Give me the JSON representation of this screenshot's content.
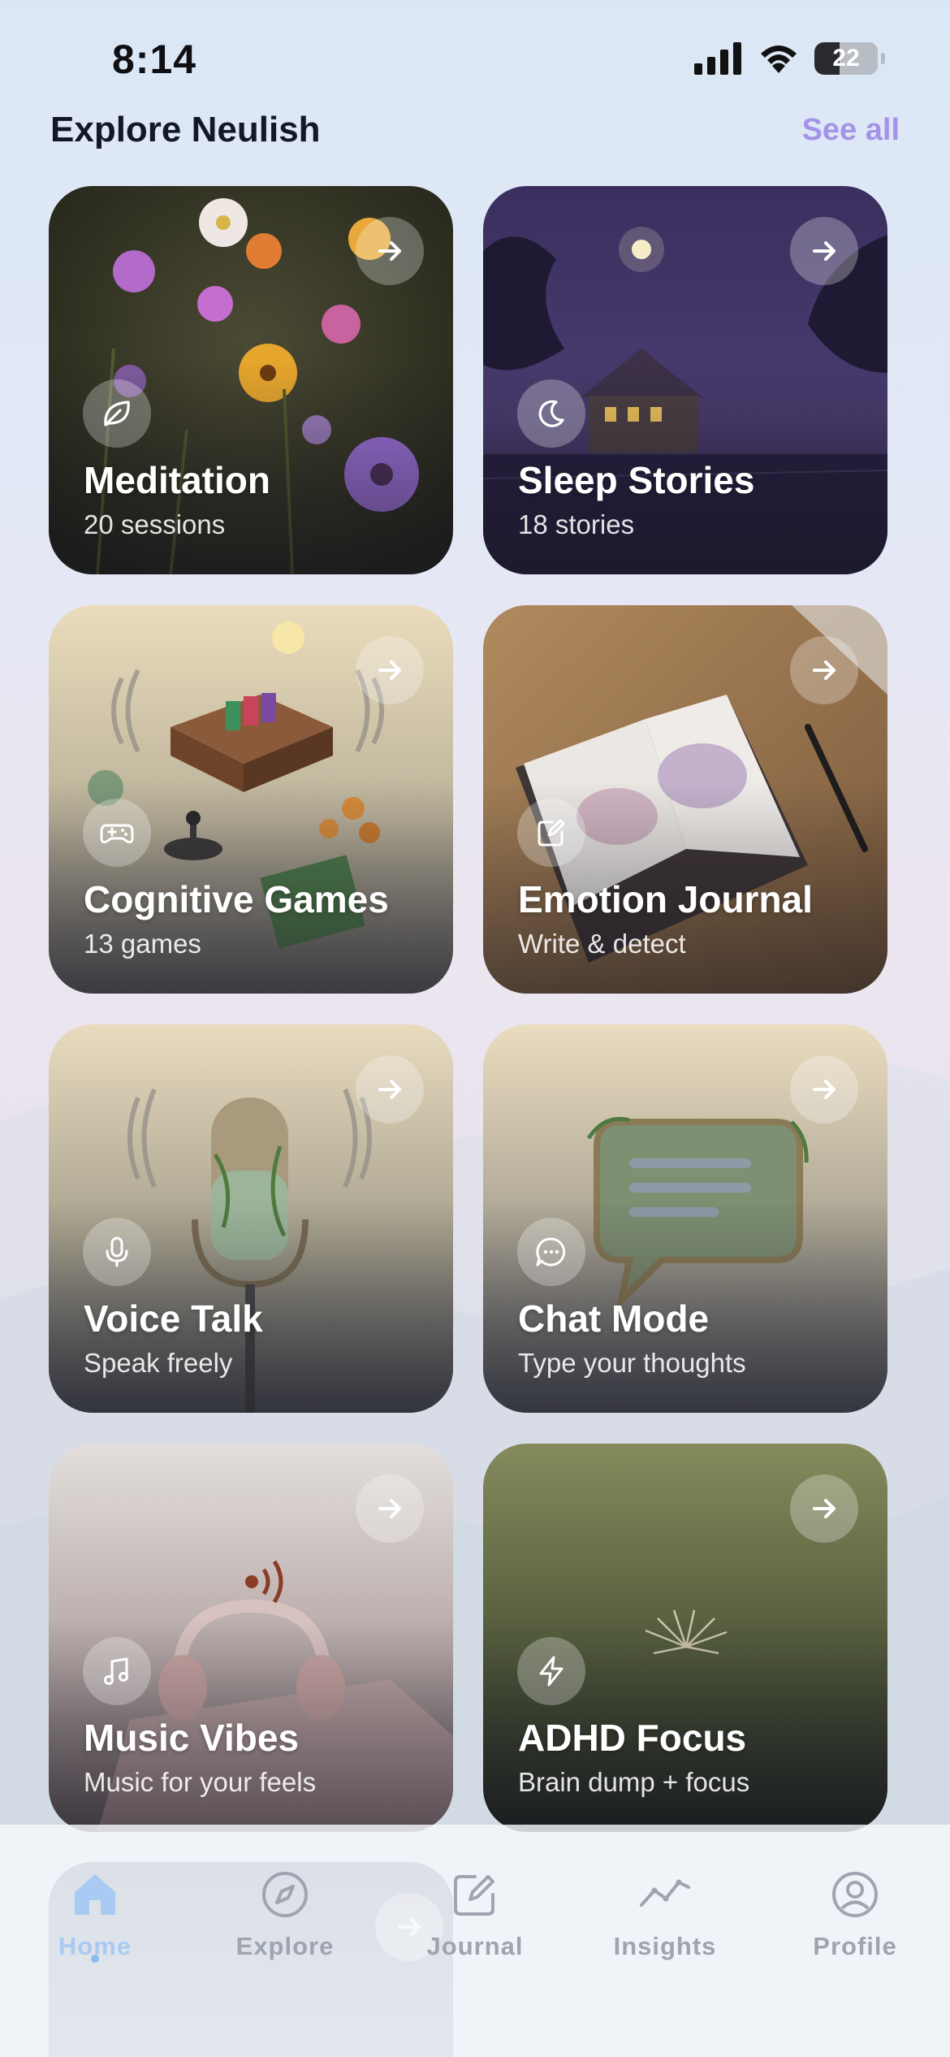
{
  "status_bar": {
    "time": "8:14",
    "battery": "22"
  },
  "header": {
    "title": "Explore Neulish",
    "see_all": "See all"
  },
  "cards": [
    {
      "title": "Meditation",
      "subtitle": "20 sessions",
      "icon": "leaf-icon"
    },
    {
      "title": "Sleep Stories",
      "subtitle": "18 stories",
      "icon": "moon-icon"
    },
    {
      "title": "Cognitive Games",
      "subtitle": "13 games",
      "icon": "gamepad-icon"
    },
    {
      "title": "Emotion Journal",
      "subtitle": "Write & detect",
      "icon": "edit-icon"
    },
    {
      "title": "Voice Talk",
      "subtitle": "Speak freely",
      "icon": "microphone-icon"
    },
    {
      "title": "Chat Mode",
      "subtitle": "Type your thoughts",
      "icon": "chat-bubble-icon"
    },
    {
      "title": "Music Vibes",
      "subtitle": "Music for your feels",
      "icon": "music-note-icon"
    },
    {
      "title": "ADHD Focus",
      "subtitle": "Brain dump + focus",
      "icon": "lightning-icon"
    }
  ],
  "tab_bar": {
    "active": "Home",
    "tabs": [
      {
        "label": "Home",
        "icon": "home-icon"
      },
      {
        "label": "Explore",
        "icon": "compass-icon"
      },
      {
        "label": "Journal",
        "icon": "edit-icon"
      },
      {
        "label": "Insights",
        "icon": "chart-line-icon"
      },
      {
        "label": "Profile",
        "icon": "user-circle-icon"
      }
    ]
  },
  "colors": {
    "accent": "#a493e8",
    "active_tab": "#a9cbf3",
    "inactive_tab": "#9ea4b0",
    "title": "#14172a"
  }
}
